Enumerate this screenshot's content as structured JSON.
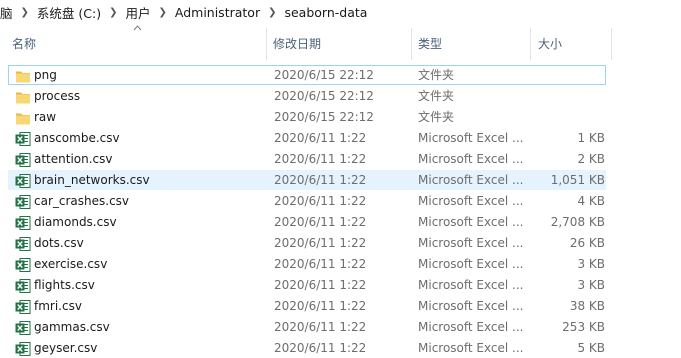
{
  "breadcrumb": [
    "脑",
    "系统盘 (C:)",
    "用户",
    "Administrator",
    "seaborn-data"
  ],
  "columns": {
    "name": "名称",
    "date": "修改日期",
    "type": "类型",
    "size": "大小"
  },
  "files": [
    {
      "name": "png",
      "date": "2020/6/15 22:12",
      "type": "文件夹",
      "size": "",
      "icon": "folder-icon"
    },
    {
      "name": "process",
      "date": "2020/6/15 22:12",
      "type": "文件夹",
      "size": "",
      "icon": "folder-icon"
    },
    {
      "name": "raw",
      "date": "2020/6/15 22:12",
      "type": "文件夹",
      "size": "",
      "icon": "folder-icon"
    },
    {
      "name": "anscombe.csv",
      "date": "2020/6/11 1:22",
      "type": "Microsoft Excel ...",
      "size": "1 KB",
      "icon": "excel-icon"
    },
    {
      "name": "attention.csv",
      "date": "2020/6/11 1:22",
      "type": "Microsoft Excel ...",
      "size": "2 KB",
      "icon": "excel-icon"
    },
    {
      "name": "brain_networks.csv",
      "date": "2020/6/11 1:22",
      "type": "Microsoft Excel ...",
      "size": "1,051 KB",
      "icon": "excel-icon"
    },
    {
      "name": "car_crashes.csv",
      "date": "2020/6/11 1:22",
      "type": "Microsoft Excel ...",
      "size": "4 KB",
      "icon": "excel-icon"
    },
    {
      "name": "diamonds.csv",
      "date": "2020/6/11 1:22",
      "type": "Microsoft Excel ...",
      "size": "2,708 KB",
      "icon": "excel-icon"
    },
    {
      "name": "dots.csv",
      "date": "2020/6/11 1:22",
      "type": "Microsoft Excel ...",
      "size": "26 KB",
      "icon": "excel-icon"
    },
    {
      "name": "exercise.csv",
      "date": "2020/6/11 1:22",
      "type": "Microsoft Excel ...",
      "size": "3 KB",
      "icon": "excel-icon"
    },
    {
      "name": "flights.csv",
      "date": "2020/6/11 1:22",
      "type": "Microsoft Excel ...",
      "size": "3 KB",
      "icon": "excel-icon"
    },
    {
      "name": "fmri.csv",
      "date": "2020/6/11 1:22",
      "type": "Microsoft Excel ...",
      "size": "38 KB",
      "icon": "excel-icon"
    },
    {
      "name": "gammas.csv",
      "date": "2020/6/11 1:22",
      "type": "Microsoft Excel ...",
      "size": "253 KB",
      "icon": "excel-icon"
    },
    {
      "name": "geyser.csv",
      "date": "2020/6/11 1:22",
      "type": "Microsoft Excel ...",
      "size": "5 KB",
      "icon": "excel-icon"
    }
  ],
  "focused_file": "png",
  "hovered_file": "brain_networks.csv",
  "colors": {
    "folder": "#f8d775",
    "folder_dark": "#e8b93b",
    "excel_green": "#217346",
    "hover_bg": "#e5f3ff",
    "focus_border": "#99d1ff",
    "header_text": "#4c607a"
  }
}
